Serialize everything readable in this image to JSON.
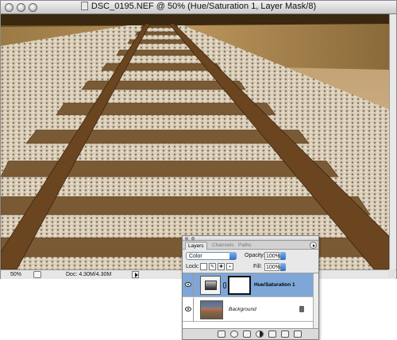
{
  "document": {
    "title": "DSC_0195.NEF @ 50% (Hue/Saturation 1, Layer Mask/8)",
    "zoom": "50%",
    "doc_size": "Doc: 4.30M/4.30M"
  },
  "layers_panel": {
    "tabs": [
      "Layers",
      "Channels",
      "Paths"
    ],
    "blend_mode": "Color",
    "opacity_label": "Opacity:",
    "opacity_value": "100%",
    "lock_label": "Lock:",
    "fill_label": "Fill:",
    "fill_value": "100%",
    "layers": [
      {
        "name": "Hue/Saturation 1",
        "selected": true,
        "visible": true,
        "type": "adjustment"
      },
      {
        "name": "Background",
        "selected": false,
        "visible": true,
        "type": "image",
        "locked": true
      }
    ]
  },
  "colors": {
    "selected_row": "#7ea7d8",
    "aqua_blue": "#2f6fc4",
    "photo_tone": "#8a6430"
  }
}
